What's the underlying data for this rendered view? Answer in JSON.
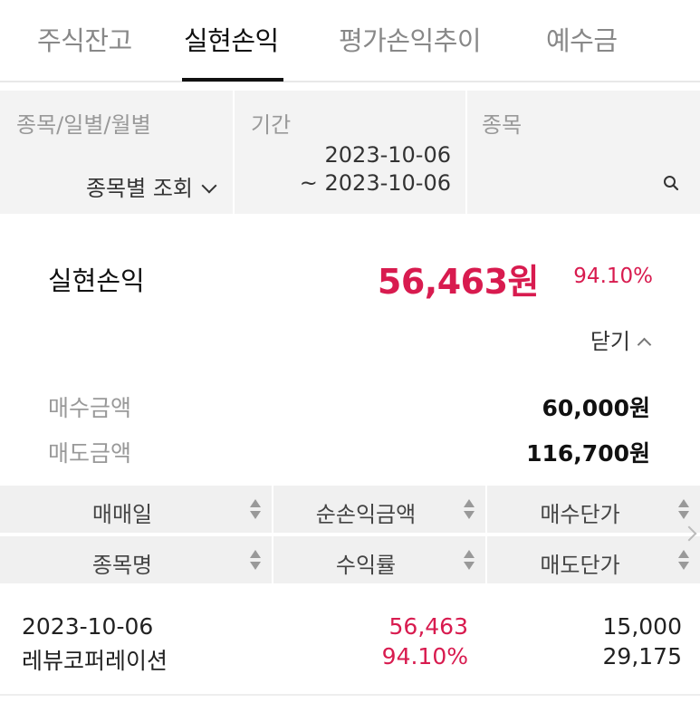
{
  "tabs": [
    {
      "label": "주식잔고",
      "active": false
    },
    {
      "label": "실현손익",
      "active": true
    },
    {
      "label": "평가손익추이",
      "active": false
    },
    {
      "label": "예수금",
      "active": false
    }
  ],
  "filter": {
    "mode_label": "종목/일별/월별",
    "mode_value": "종목별 조회",
    "period_label": "기간",
    "period_start": "2023-10-06",
    "period_end": "~ 2023-10-06",
    "stock_label": "종목",
    "stock_value": ""
  },
  "summary": {
    "label": "실현손익",
    "amount": "56,463원",
    "rate": "94.10%",
    "close_label": "닫기",
    "buy_label": "매수금액",
    "buy_value": "60,000원",
    "sell_label": "매도금액",
    "sell_value": "116,700원"
  },
  "table": {
    "headers_row1": [
      "매매일",
      "순손익금액",
      "매수단가"
    ],
    "headers_row2": [
      "종목명",
      "수익률",
      "매도단가"
    ],
    "rows": [
      {
        "date": "2023-10-06",
        "name": "레뷰코퍼레이션",
        "net_profit": "56,463",
        "rate": "94.10%",
        "buy_price": "15,000",
        "sell_price": "29,175"
      }
    ]
  },
  "colors": {
    "accent": "#d81b4f",
    "filter_bg": "#f3f3f3",
    "header_bg": "#f0f0f0"
  }
}
